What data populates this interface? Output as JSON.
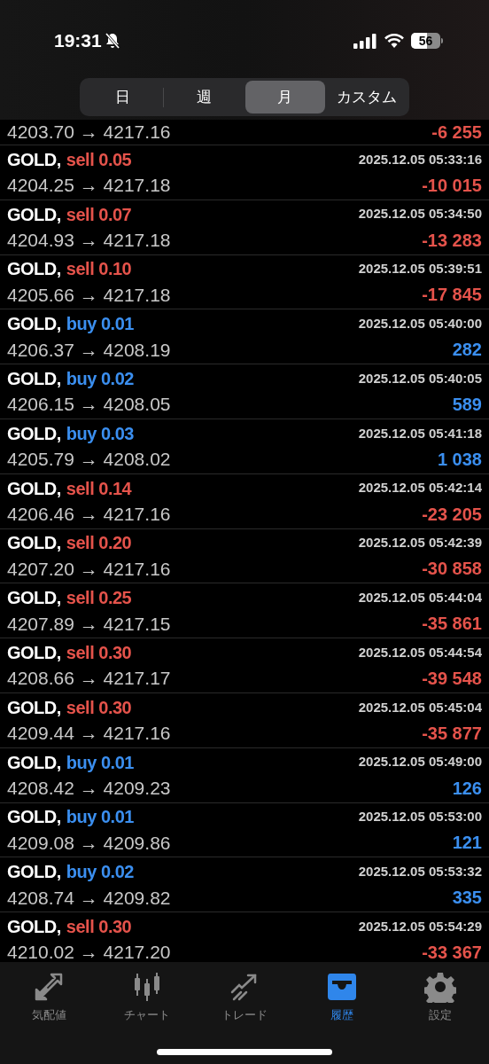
{
  "status_bar": {
    "time": "19:31",
    "battery": "56"
  },
  "tabs": [
    {
      "label": "日",
      "selected": false
    },
    {
      "label": "週",
      "selected": false
    },
    {
      "label": "月",
      "selected": true
    },
    {
      "label": "カスタム",
      "selected": false
    }
  ],
  "partial_row": {
    "prices": "4203.70 → 4217.16",
    "profit": "-6 255",
    "kind": "sell"
  },
  "deals": [
    {
      "symbol": "GOLD,",
      "order": "sell 0.05",
      "kind": "sell",
      "time": "2025.12.05 05:33:16",
      "prices": "4204.25 → 4217.18",
      "profit": "-10 015"
    },
    {
      "symbol": "GOLD,",
      "order": "sell 0.07",
      "kind": "sell",
      "time": "2025.12.05 05:34:50",
      "prices": "4204.93 → 4217.18",
      "profit": "-13 283"
    },
    {
      "symbol": "GOLD,",
      "order": "sell 0.10",
      "kind": "sell",
      "time": "2025.12.05 05:39:51",
      "prices": "4205.66 → 4217.18",
      "profit": "-17 845"
    },
    {
      "symbol": "GOLD,",
      "order": "buy 0.01",
      "kind": "buy",
      "time": "2025.12.05 05:40:00",
      "prices": "4206.37 → 4208.19",
      "profit": "282"
    },
    {
      "symbol": "GOLD,",
      "order": "buy 0.02",
      "kind": "buy",
      "time": "2025.12.05 05:40:05",
      "prices": "4206.15 → 4208.05",
      "profit": "589"
    },
    {
      "symbol": "GOLD,",
      "order": "buy 0.03",
      "kind": "buy",
      "time": "2025.12.05 05:41:18",
      "prices": "4205.79 → 4208.02",
      "profit": "1 038"
    },
    {
      "symbol": "GOLD,",
      "order": "sell 0.14",
      "kind": "sell",
      "time": "2025.12.05 05:42:14",
      "prices": "4206.46 → 4217.16",
      "profit": "-23 205"
    },
    {
      "symbol": "GOLD,",
      "order": "sell 0.20",
      "kind": "sell",
      "time": "2025.12.05 05:42:39",
      "prices": "4207.20 → 4217.16",
      "profit": "-30 858"
    },
    {
      "symbol": "GOLD,",
      "order": "sell 0.25",
      "kind": "sell",
      "time": "2025.12.05 05:44:04",
      "prices": "4207.89 → 4217.15",
      "profit": "-35 861"
    },
    {
      "symbol": "GOLD,",
      "order": "sell 0.30",
      "kind": "sell",
      "time": "2025.12.05 05:44:54",
      "prices": "4208.66 → 4217.17",
      "profit": "-39 548"
    },
    {
      "symbol": "GOLD,",
      "order": "sell 0.30",
      "kind": "sell",
      "time": "2025.12.05 05:45:04",
      "prices": "4209.44 → 4217.16",
      "profit": "-35 877"
    },
    {
      "symbol": "GOLD,",
      "order": "buy 0.01",
      "kind": "buy",
      "time": "2025.12.05 05:49:00",
      "prices": "4208.42 → 4209.23",
      "profit": "126"
    },
    {
      "symbol": "GOLD,",
      "order": "buy 0.01",
      "kind": "buy",
      "time": "2025.12.05 05:53:00",
      "prices": "4209.08 → 4209.86",
      "profit": "121"
    },
    {
      "symbol": "GOLD,",
      "order": "buy 0.02",
      "kind": "buy",
      "time": "2025.12.05 05:53:32",
      "prices": "4208.74 → 4209.82",
      "profit": "335"
    },
    {
      "symbol": "GOLD,",
      "order": "sell 0.30",
      "kind": "sell",
      "time": "2025.12.05 05:54:29",
      "prices": "4210.02 → 4217.20",
      "profit": "-33 367"
    }
  ],
  "nav": [
    {
      "label": "気配値",
      "kind": "quotes",
      "selected": false
    },
    {
      "label": "チャート",
      "kind": "chart",
      "selected": false
    },
    {
      "label": "トレード",
      "kind": "trade",
      "selected": false
    },
    {
      "label": "履歴",
      "kind": "history",
      "selected": true
    },
    {
      "label": "設定",
      "kind": "settings",
      "selected": false
    }
  ]
}
